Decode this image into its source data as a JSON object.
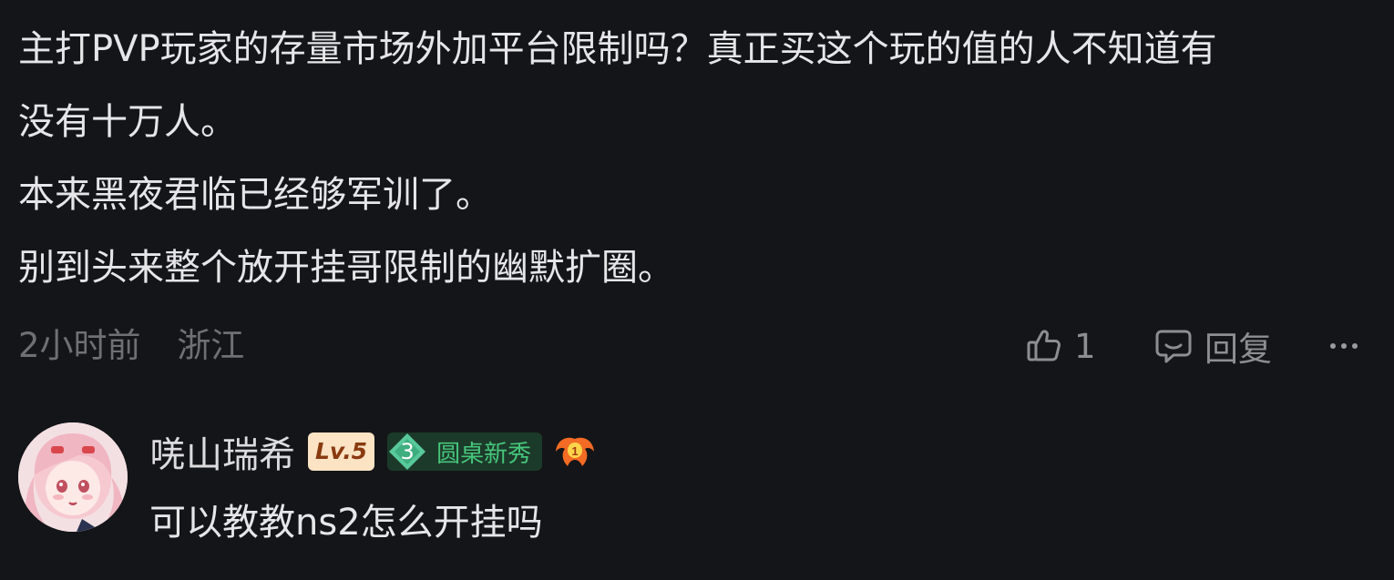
{
  "post": {
    "lines": [
      "主打PVP玩家的存量市场外加平台限制吗？真正买这个玩的值的人不知道有",
      "没有十万人。",
      "本来黑夜君临已经够军训了。",
      "别到头来整个放开挂哥限制的幽默扩圈。"
    ],
    "time": "2小时前",
    "location": "浙江",
    "like_count": "1",
    "reply_label": "回复",
    "icons": {
      "like": "thumbs-up-icon",
      "reply": "comment-bubble-icon",
      "more": "more-dots-icon"
    }
  },
  "reply": {
    "username": "唴山瑞希",
    "level": "Lv.5",
    "title_rank": "3",
    "title_text": "圆桌新秀",
    "medal_number": "1",
    "content": "可以教教ns2怎么开挂吗"
  },
  "colors": {
    "background": "#141518",
    "text_primary": "#e6e6e8",
    "text_muted": "#6f7075",
    "level_badge_bg": "#fbe3c4",
    "level_badge_text": "#8a3a10",
    "title_badge_bg": "#1c3a2a",
    "title_badge_text": "#47c57b"
  }
}
